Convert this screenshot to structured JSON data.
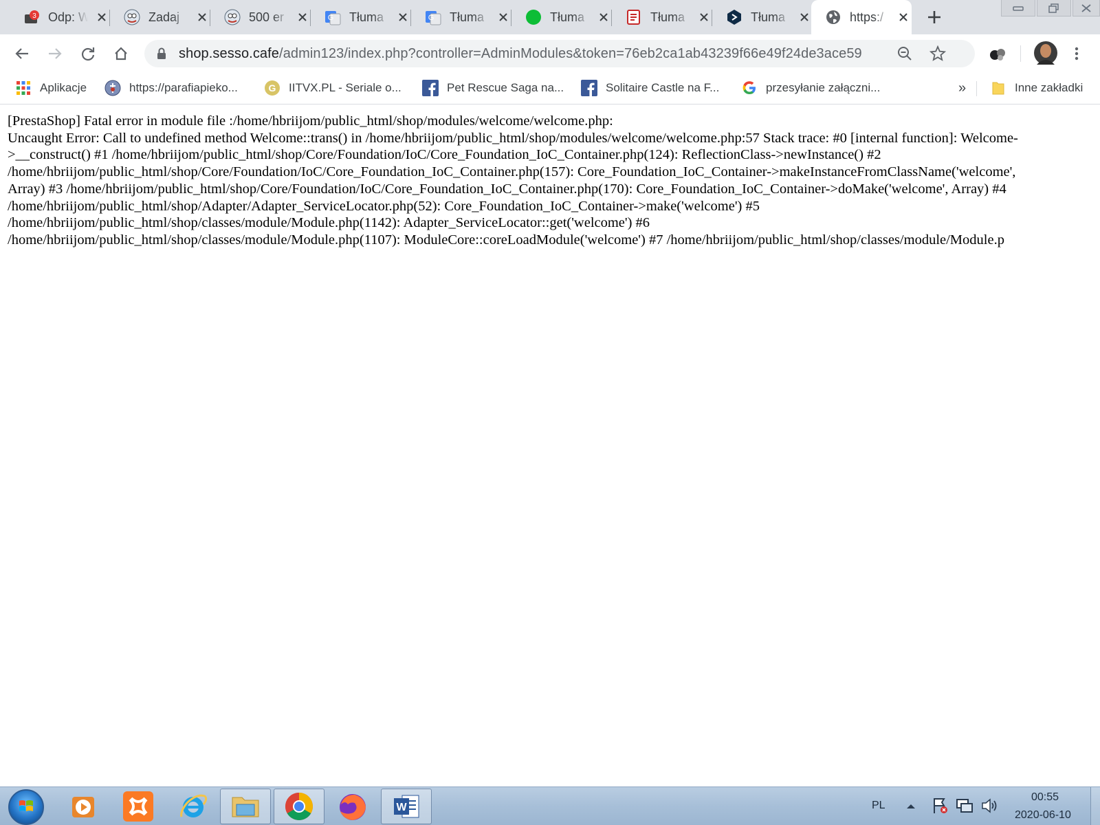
{
  "tabs": [
    {
      "title": "Odp: W",
      "icon": "mail-icon",
      "badge": "3"
    },
    {
      "title": "Zadaj",
      "icon": "prestashop-icon"
    },
    {
      "title": "500 er",
      "icon": "prestashop-icon"
    },
    {
      "title": "Tłuma",
      "icon": "google-translate-icon"
    },
    {
      "title": "Tłuma",
      "icon": "google-translate-icon"
    },
    {
      "title": "Tłuma",
      "icon": "green-circle-icon"
    },
    {
      "title": "Tłuma",
      "icon": "red-document-icon"
    },
    {
      "title": "Tłuma",
      "icon": "deepl-icon"
    },
    {
      "title": "https:/",
      "icon": "globe-icon",
      "active": true
    }
  ],
  "omnibox": {
    "host": "shop.sesso.cafe",
    "path": "/admin123/index.php?controller=AdminModules&token=76eb2ca1ab43239f66e49f24de3ace59"
  },
  "bookmarks": [
    {
      "label": "Aplikacje",
      "icon": "apps-grid-icon"
    },
    {
      "label": "https://parafiapieko...",
      "icon": "parish-icon"
    },
    {
      "label": "IITVX.PL - Seriale o...",
      "icon": "iitvx-icon"
    },
    {
      "label": "Pet Rescue Saga na...",
      "icon": "facebook-icon"
    },
    {
      "label": "Solitaire Castle na F...",
      "icon": "facebook-icon"
    },
    {
      "label": "przesyłanie załączni...",
      "icon": "google-icon"
    }
  ],
  "bookmarks_overflow": "»",
  "other_bookmarks": "Inne zakładki",
  "page": {
    "lines": [
      "[PrestaShop] Fatal error in module file :/home/hbriijom/public_html/shop/modules/welcome/welcome.php:",
      "Uncaught Error: Call to undefined method Welcome::trans() in /home/hbriijom/public_html/shop/modules/welcome/welcome.php:57 Stack trace: #0 [internal function]: Welcome-",
      ">__construct() #1 /home/hbriijom/public_html/shop/Core/Foundation/IoC/Core_Foundation_IoC_Container.php(124): ReflectionClass->newInstance() #2",
      "/home/hbriijom/public_html/shop/Core/Foundation/IoC/Core_Foundation_IoC_Container.php(157): Core_Foundation_IoC_Container->makeInstanceFromClassName('welcome',",
      "Array) #3 /home/hbriijom/public_html/shop/Core/Foundation/IoC/Core_Foundation_IoC_Container.php(170): Core_Foundation_IoC_Container->doMake('welcome', Array) #4",
      "/home/hbriijom/public_html/shop/Adapter/Adapter_ServiceLocator.php(52): Core_Foundation_IoC_Container->make('welcome') #5",
      "/home/hbriijom/public_html/shop/classes/module/Module.php(1142): Adapter_ServiceLocator::get('welcome') #6",
      "/home/hbriijom/public_html/shop/classes/module/Module.php(1107): ModuleCore::coreLoadModule('welcome') #7 /home/hbriijom/public_html/shop/classes/module/Module.p"
    ]
  },
  "taskbar": {
    "apps": [
      "media-player-icon",
      "xampp-icon",
      "internet-explorer-icon",
      "file-explorer-icon",
      "chrome-icon",
      "firefox-icon",
      "word-icon"
    ],
    "language": "PL",
    "time": "00:55",
    "date": "2020-06-10"
  },
  "colors": {
    "tabstrip": "#dee1e6",
    "omnibox": "#f1f3f4",
    "taskbar": "#a7bfd8"
  }
}
